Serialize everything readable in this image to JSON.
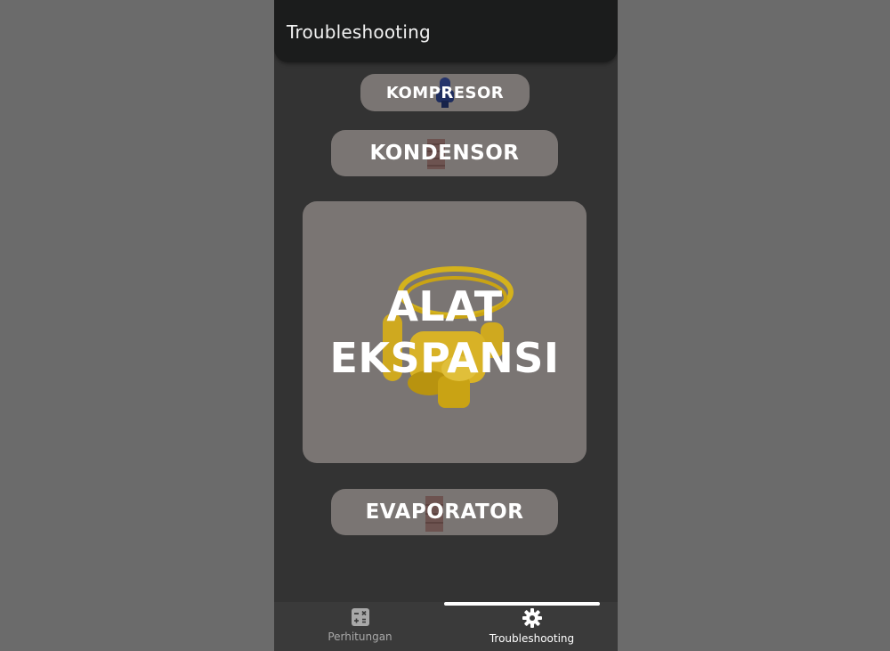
{
  "appbar": {
    "title": "Troubleshooting"
  },
  "buttons": {
    "kompresor": "KOMPRESOR",
    "kondensor": "KONDENSOR",
    "ekspansi_line1": "ALAT",
    "ekspansi_line2": "EKSPANSI",
    "evaporator": "EVAPORATOR"
  },
  "bottom_nav": {
    "items": [
      {
        "label": "Perhitungan",
        "icon": "calculator-icon",
        "active": false
      },
      {
        "label": "Troubleshooting",
        "icon": "gear-icon",
        "active": true
      }
    ]
  },
  "colors": {
    "background": "#6b6b6b",
    "phone_background": "#333333",
    "appbar": "#1b1c1c",
    "button": "#7a7573",
    "nav_bar": "#3a3a3a",
    "nav_active": "#ffffff",
    "nav_inactive": "#a8a8a8"
  }
}
